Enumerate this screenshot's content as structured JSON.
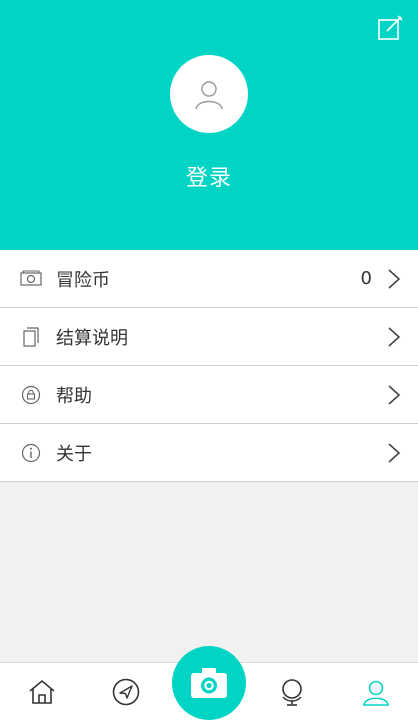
{
  "header": {
    "background_color": "#00d5c5",
    "login_label": "登录",
    "edit_icon": "edit-icon",
    "avatar_icon": "user-icon"
  },
  "menu": {
    "items": [
      {
        "icon": "money-icon",
        "label": "冒险币",
        "value": "0"
      },
      {
        "icon": "document-icon",
        "label": "结算说明",
        "value": ""
      },
      {
        "icon": "help-icon",
        "label": "帮助",
        "value": ""
      },
      {
        "icon": "info-icon",
        "label": "关于",
        "value": ""
      }
    ]
  },
  "tabbar": {
    "active_color": "#00d5c5",
    "inactive_color": "#333333",
    "tabs": [
      {
        "icon": "home-icon",
        "active": false
      },
      {
        "icon": "send-icon",
        "active": false
      },
      {
        "icon": "camera-icon",
        "active": false
      },
      {
        "icon": "globe-icon",
        "active": false
      },
      {
        "icon": "profile-icon",
        "active": true
      }
    ]
  }
}
